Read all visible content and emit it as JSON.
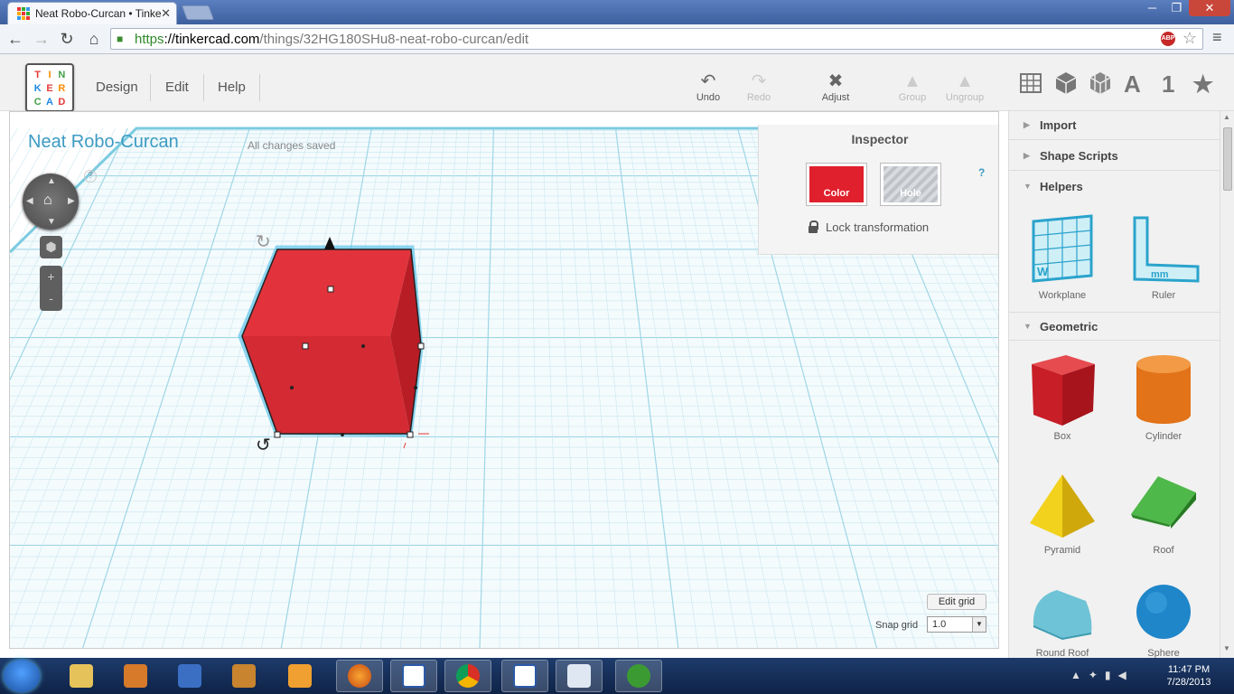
{
  "browser": {
    "tab_title": "Neat Robo-Curcan • Tinke",
    "url_https": "https",
    "url_domain": "://tinkercad.com",
    "url_path": "/things/32HG180SHu8-neat-robo-curcan/edit",
    "abp_label": "ABP"
  },
  "app": {
    "logo_letters": [
      "T",
      "I",
      "N",
      "K",
      "E",
      "R",
      "C",
      "A",
      "D"
    ],
    "menu": [
      "Design",
      "Edit",
      "Help"
    ],
    "toolbar": {
      "undo": "Undo",
      "redo": "Redo",
      "adjust": "Adjust",
      "group": "Group",
      "ungroup": "Ungroup"
    },
    "side_tabs": {
      "text_tab": "A",
      "number_tab": "1"
    }
  },
  "workspace": {
    "project_title": "Neat Robo-Curcan",
    "save_status": "All changes saved",
    "help": "?",
    "edit_grid": "Edit grid",
    "snap_label": "Snap grid",
    "snap_value": "1.0"
  },
  "inspector": {
    "title": "Inspector",
    "color_label": "Color",
    "hole_label": "Hole",
    "lock_label": "Lock transformation",
    "help": "?",
    "selected_color": "#e0202c"
  },
  "sidebar": {
    "sections": {
      "import": "Import",
      "shape_scripts": "Shape Scripts",
      "helpers": "Helpers",
      "geometric": "Geometric"
    },
    "helpers": [
      "Workplane",
      "Ruler"
    ],
    "ruler_unit": "mm",
    "workplane_letter": "W",
    "geometric": [
      "Box",
      "Cylinder",
      "Pyramid",
      "Roof",
      "Round Roof",
      "Sphere"
    ]
  },
  "taskbar": {
    "time": "11:47 PM",
    "date": "7/28/2013"
  }
}
